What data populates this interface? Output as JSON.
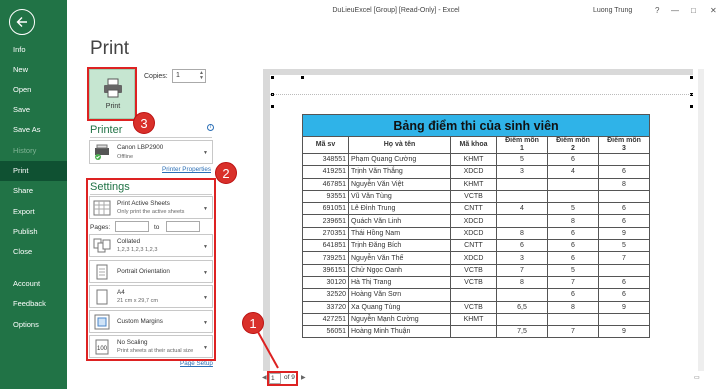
{
  "window": {
    "title": "DuLieuExcel  [Group]  [Read-Only] - Excel",
    "user": "Luong Trung",
    "help": "?"
  },
  "sidebar": {
    "items": [
      "Info",
      "New",
      "Open",
      "Save",
      "Save As",
      "History",
      "Print",
      "Share",
      "Export",
      "Publish",
      "Close",
      "Account",
      "Feedback",
      "Options"
    ]
  },
  "print": {
    "title": "Print",
    "button_label": "Print",
    "copies_label": "Copies:",
    "copies_value": "1"
  },
  "printer": {
    "section": "Printer",
    "name": "Canon LBP2900",
    "status": "Offline",
    "properties_link": "Printer Properties"
  },
  "settings": {
    "section": "Settings",
    "active_sheets": {
      "main": "Print Active Sheets",
      "sub": "Only print the active sheets"
    },
    "pages_label": "Pages:",
    "to_label": "to",
    "collated": {
      "main": "Collated",
      "sub": "1,2,3   1,2,3   1,2,3"
    },
    "orientation": {
      "main": "Portrait Orientation"
    },
    "paper": {
      "main": "A4",
      "sub": "21 cm x 29,7 cm"
    },
    "margins": {
      "main": "Custom Margins"
    },
    "scaling": {
      "main": "No Scaling",
      "sub": "Print sheets at their actual size"
    },
    "page_setup_link": "Page Setup"
  },
  "badges": {
    "b1": "1",
    "b2": "2",
    "b3": "3"
  },
  "preview": {
    "table_title": "Bảng điểm thi của sinh viên",
    "headers": {
      "h1": "Mã sv",
      "h2": "Họ và tên",
      "h3": "Mã khoa",
      "h4a": "Điểm môn",
      "h4b": "1",
      "h5a": "Điểm môn",
      "h5b": "2",
      "h6a": "Điểm môn",
      "h6b": "3"
    },
    "rows": [
      [
        "348551",
        "Phạm Quang Cường",
        "KHMT",
        "5",
        "6",
        ""
      ],
      [
        "419251",
        "Trịnh Văn Thắng",
        "XDCD",
        "3",
        "4",
        "6"
      ],
      [
        "467851",
        "Nguyễn Văn Việt",
        "KHMT",
        "",
        "",
        "8"
      ],
      [
        "93551",
        "Vũ Văn Tùng",
        "VCTB",
        "",
        "",
        ""
      ],
      [
        "691051",
        "Lê Đình Trung",
        "CNTT",
        "4",
        "5",
        "6"
      ],
      [
        "239651",
        "Quách Văn Linh",
        "XDCD",
        "",
        "8",
        "6"
      ],
      [
        "270351",
        "Thái Hồng Nam",
        "XDCD",
        "8",
        "6",
        "9"
      ],
      [
        "641851",
        "Trịnh Đăng Bích",
        "CNTT",
        "6",
        "6",
        "5"
      ],
      [
        "739251",
        "Nguyễn Văn Thế",
        "XDCD",
        "3",
        "6",
        "7"
      ],
      [
        "396151",
        "Chử Ngọc Oanh",
        "VCTB",
        "7",
        "5",
        ""
      ],
      [
        "30120",
        "Hà Thị Trang",
        "VCTB",
        "8",
        "7",
        "6"
      ],
      [
        "32520",
        "Hoàng Văn Sơn",
        "",
        "",
        "6",
        "6"
      ],
      [
        "33720",
        "Xa Quang Tùng",
        "VCTB",
        "6,5",
        "8",
        "9"
      ],
      [
        "427251",
        "Nguyễn Mạnh Cường",
        "KHMT",
        "",
        "",
        ""
      ],
      [
        "56051",
        "Hoàng Minh Thuận",
        "",
        "7,5",
        "7",
        "9"
      ]
    ]
  },
  "pagenav": {
    "current": "1",
    "of": "of 9"
  }
}
